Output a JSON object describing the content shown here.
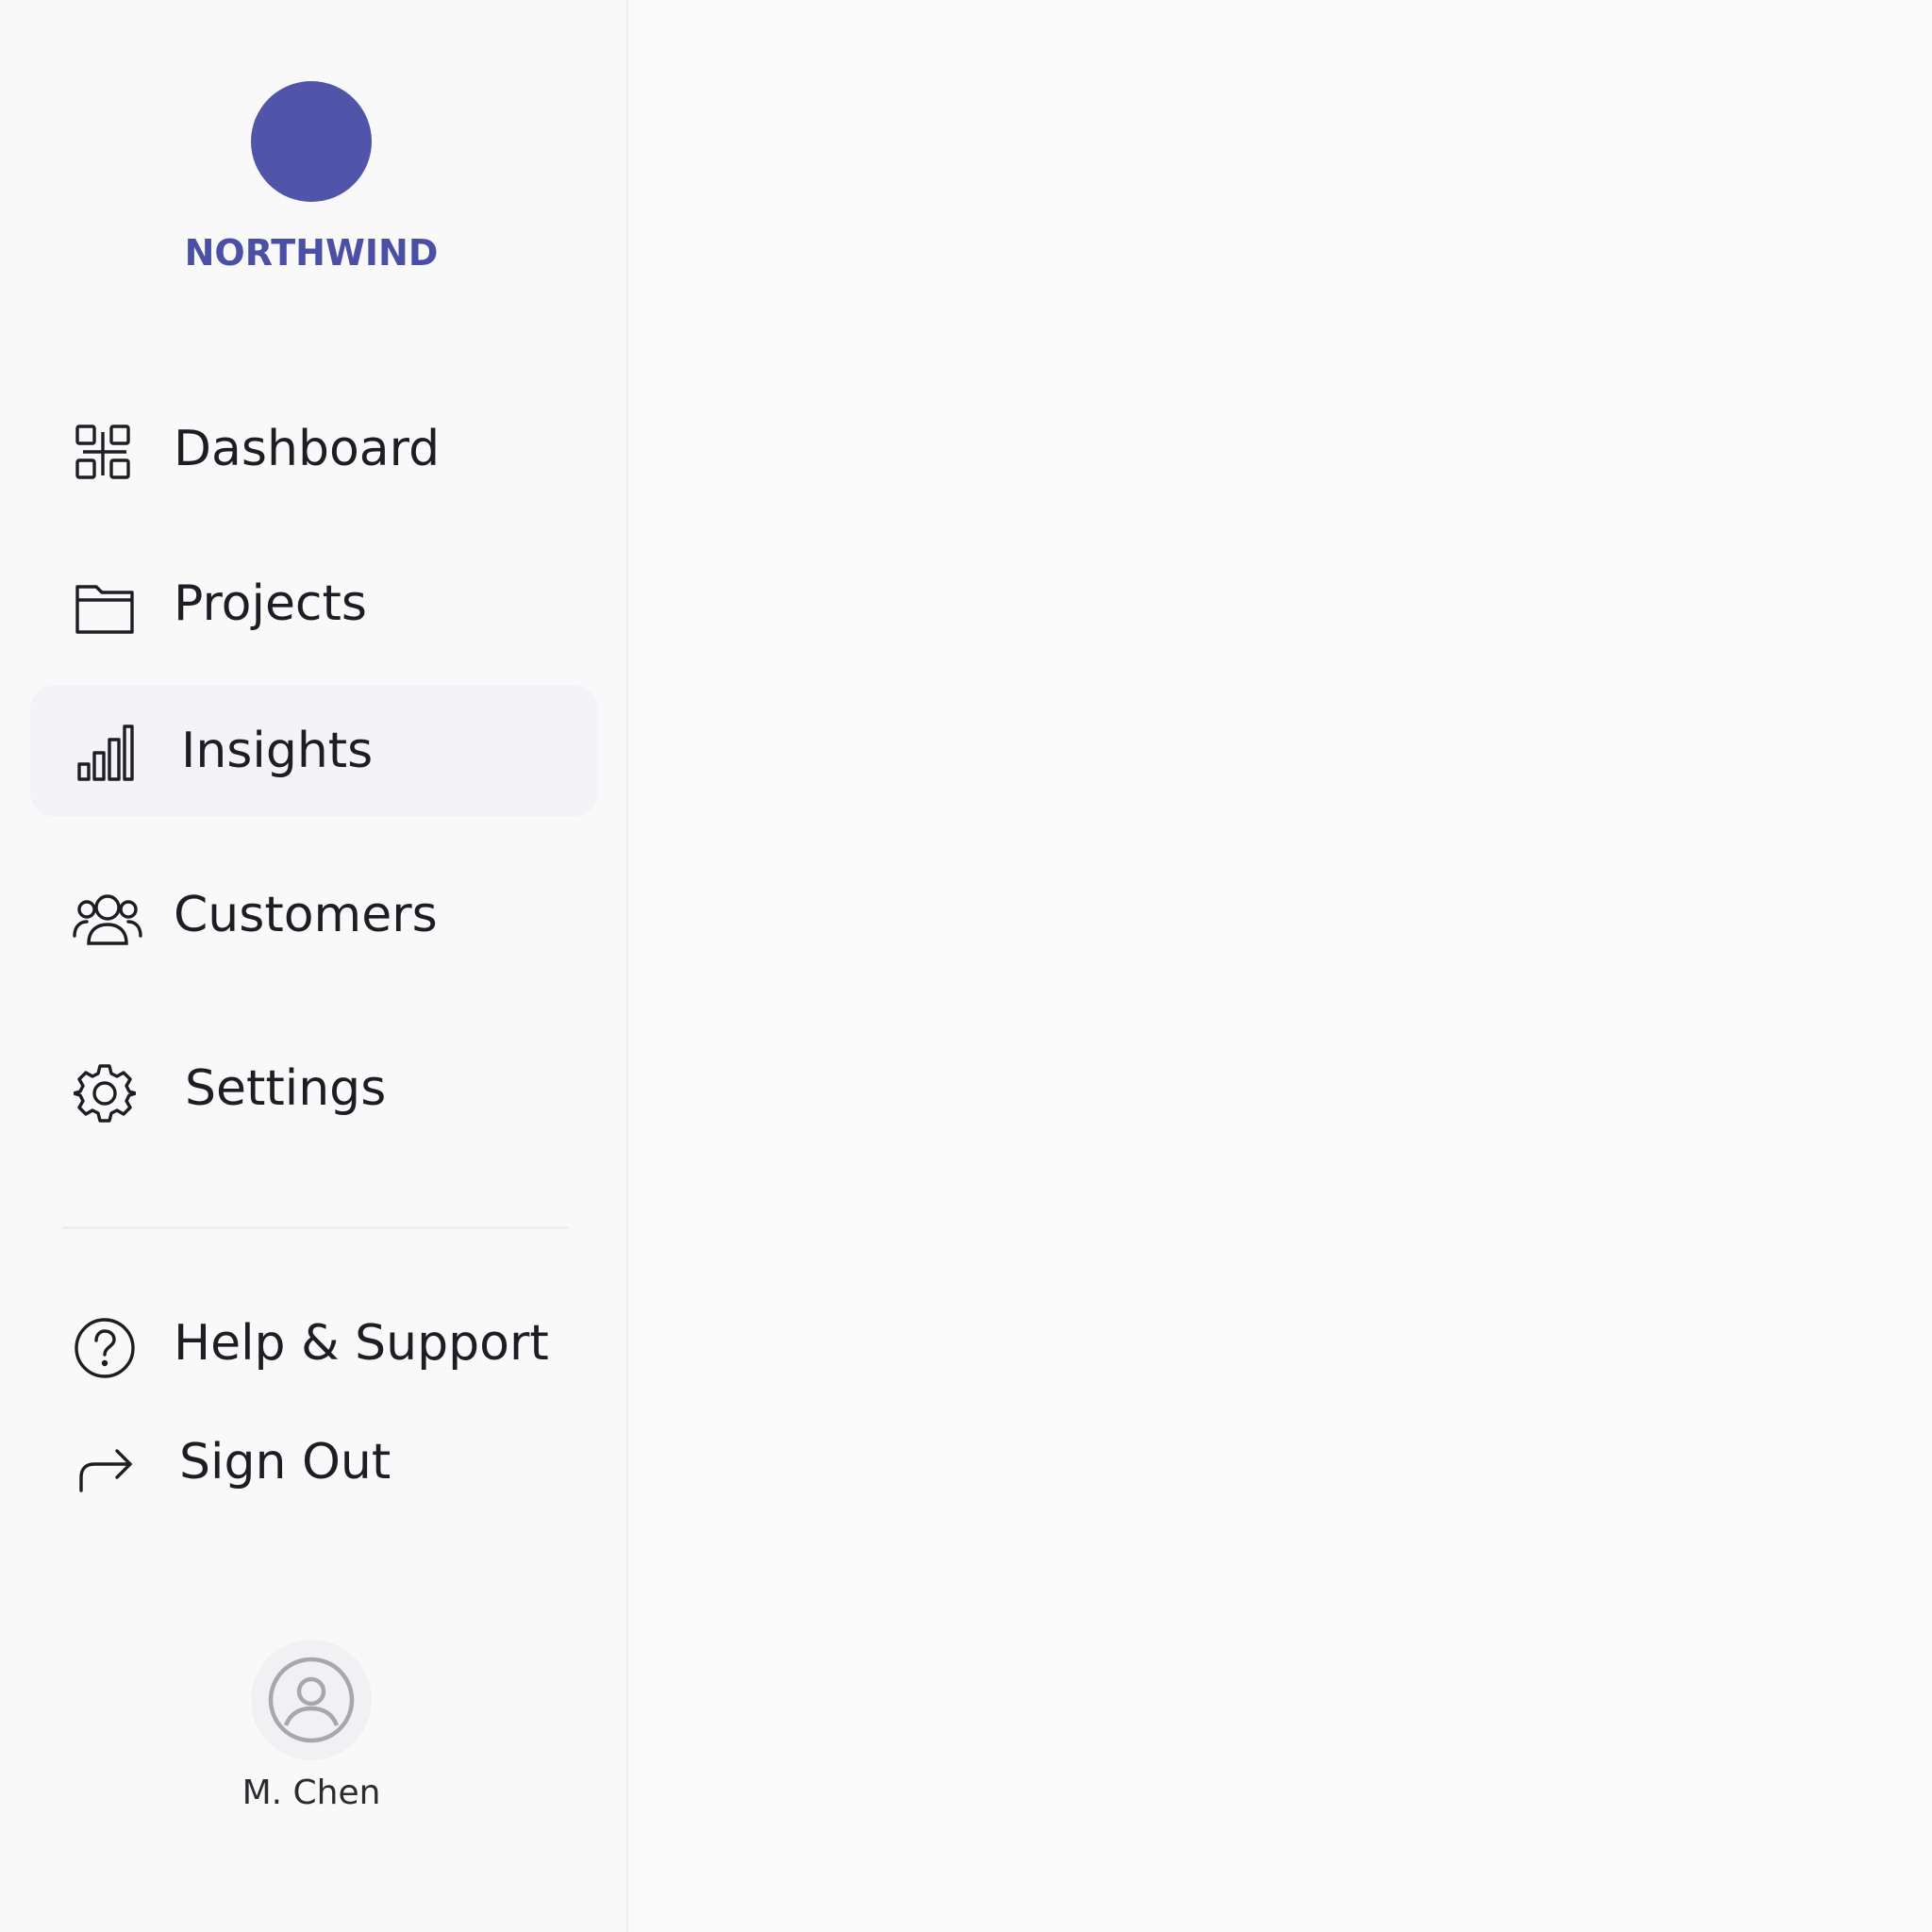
{
  "brand": {
    "name": "NORTHWIND",
    "color": "#4b4fa6"
  },
  "nav": {
    "items": [
      {
        "label": "Dashboard",
        "icon": "dashboard-grid-icon"
      },
      {
        "label": "Projects",
        "icon": "folder-icon"
      },
      {
        "label": "Insights",
        "icon": "bar-chart-icon",
        "active": true
      },
      {
        "label": "Customers",
        "icon": "users-icon"
      },
      {
        "label": "Settings",
        "icon": "gear-icon"
      }
    ],
    "secondary": [
      {
        "label": "Help & Support",
        "icon": "help-circle-icon"
      },
      {
        "label": "Sign Out",
        "icon": "sign-out-arrow-icon"
      }
    ],
    "active_background": "#f3f3f8"
  },
  "user": {
    "name": "M. Chen",
    "icon": "user-avatar-icon"
  }
}
